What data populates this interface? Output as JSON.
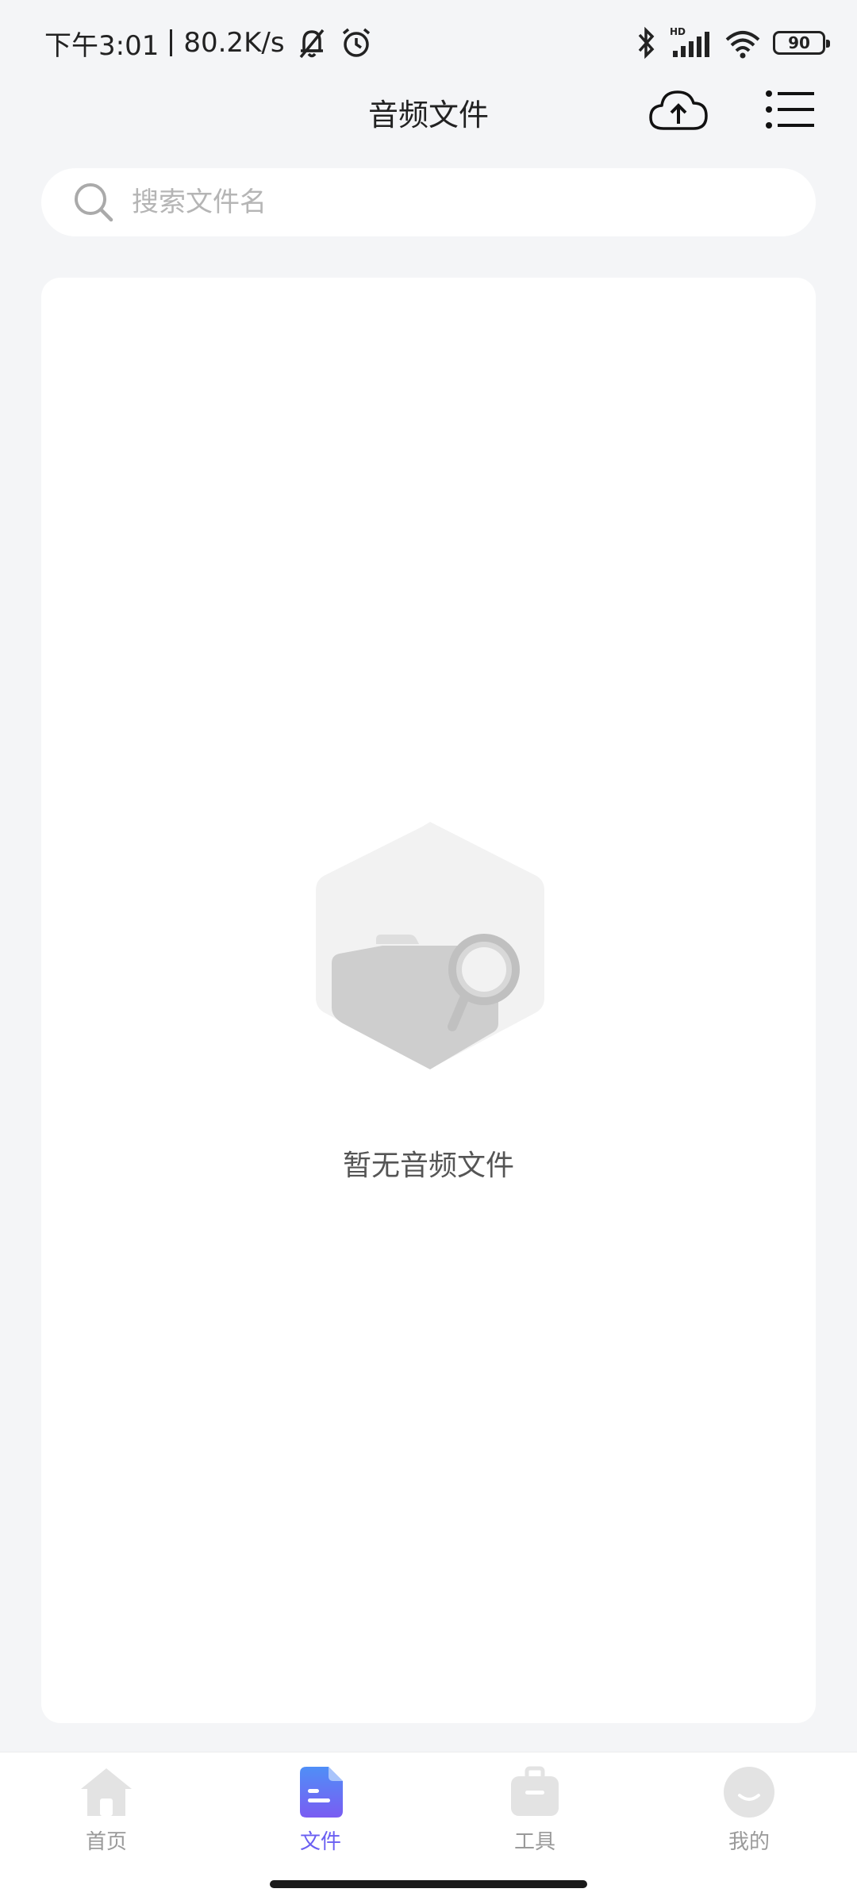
{
  "status_bar": {
    "time": "下午3:01",
    "network_speed": "80.2K/s",
    "battery_level": "90"
  },
  "header": {
    "title": "音频文件"
  },
  "search": {
    "placeholder": "搜索文件名"
  },
  "content": {
    "empty_message": "暂无音频文件"
  },
  "bottom_nav": {
    "items": [
      {
        "label": "首页",
        "icon": "home-icon",
        "active": false
      },
      {
        "label": "文件",
        "icon": "file-icon",
        "active": true
      },
      {
        "label": "工具",
        "icon": "toolbox-icon",
        "active": false
      },
      {
        "label": "我的",
        "icon": "profile-icon",
        "active": false
      }
    ]
  },
  "colors": {
    "background": "#f4f5f7",
    "card": "#ffffff",
    "accent": "#6a5ff2",
    "inactive": "#9a9a9a"
  }
}
